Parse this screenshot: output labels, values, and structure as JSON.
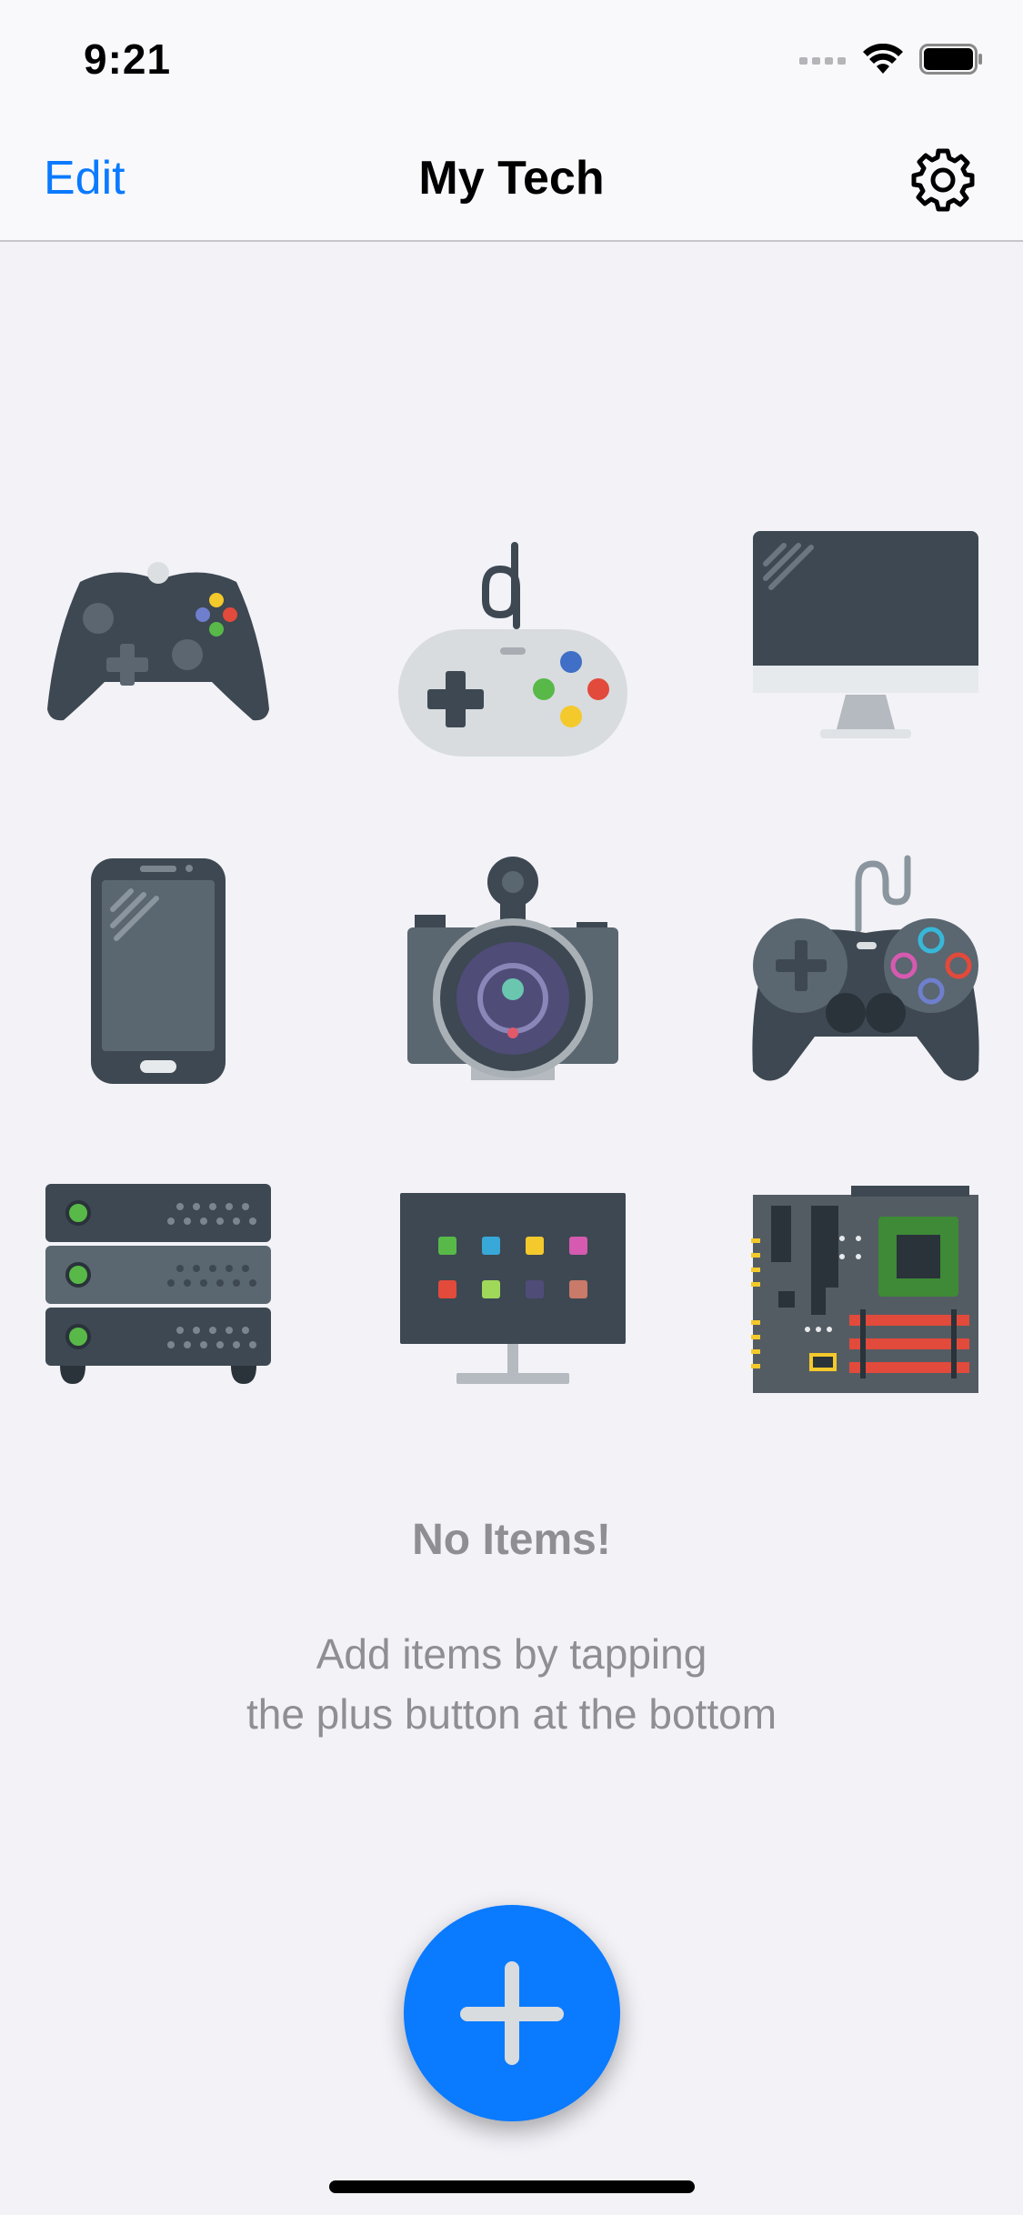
{
  "status": {
    "time": "9:21"
  },
  "nav": {
    "edit_label": "Edit",
    "title": "My Tech"
  },
  "icons": [
    "xbox-controller-icon",
    "snes-controller-icon",
    "desktop-monitor-icon",
    "smartphone-icon",
    "camera-icon",
    "playstation-controller-icon",
    "server-rack-icon",
    "tv-display-icon",
    "motherboard-icon"
  ],
  "empty_state": {
    "title": "No Items!",
    "line1": "Add items by tapping",
    "line2": "the plus button at the bottom"
  },
  "colors": {
    "accent": "#0a7aff",
    "background": "#f2f2f7",
    "secondary_text": "#8e8e93"
  }
}
